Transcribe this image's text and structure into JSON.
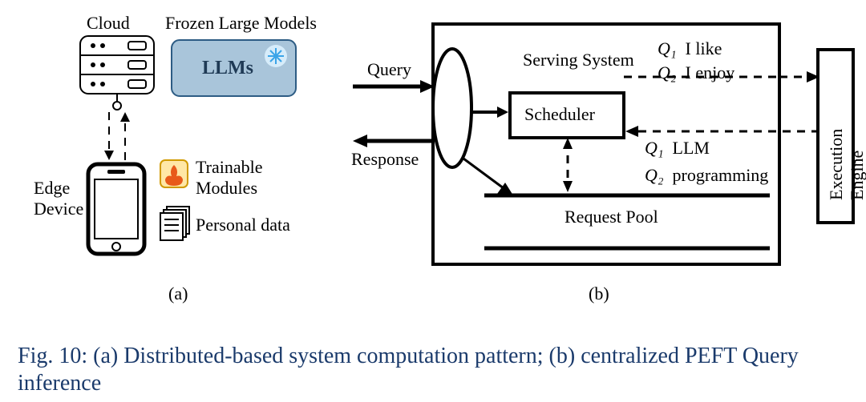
{
  "panelA": {
    "cloud_label": "Cloud",
    "frozen_label": "Frozen Large Models",
    "llm_label": "LLMs",
    "edge_label": "Edge\nDevice",
    "trainable_label": "Trainable\nModules",
    "personal_label": "Personal data",
    "sub_label": "(a)"
  },
  "panelB": {
    "query_label": "Query",
    "response_label": "Response",
    "serving_label": "Serving System",
    "scheduler_label": "Scheduler",
    "request_pool_label": "Request Pool",
    "execution_label": "Execution\nEngine",
    "queries_top": [
      {
        "id": "Q₁",
        "text": "I like"
      },
      {
        "id": "Q₂",
        "text": "I enjoy"
      }
    ],
    "queries_bottom": [
      {
        "id": "Q₁",
        "text": "LLM"
      },
      {
        "id": "Q₂",
        "text": "programming"
      }
    ],
    "sub_label": "(b)"
  },
  "caption": "Fig. 10: (a) Distributed-based system computation pattern; (b) centralized PEFT Query inference"
}
